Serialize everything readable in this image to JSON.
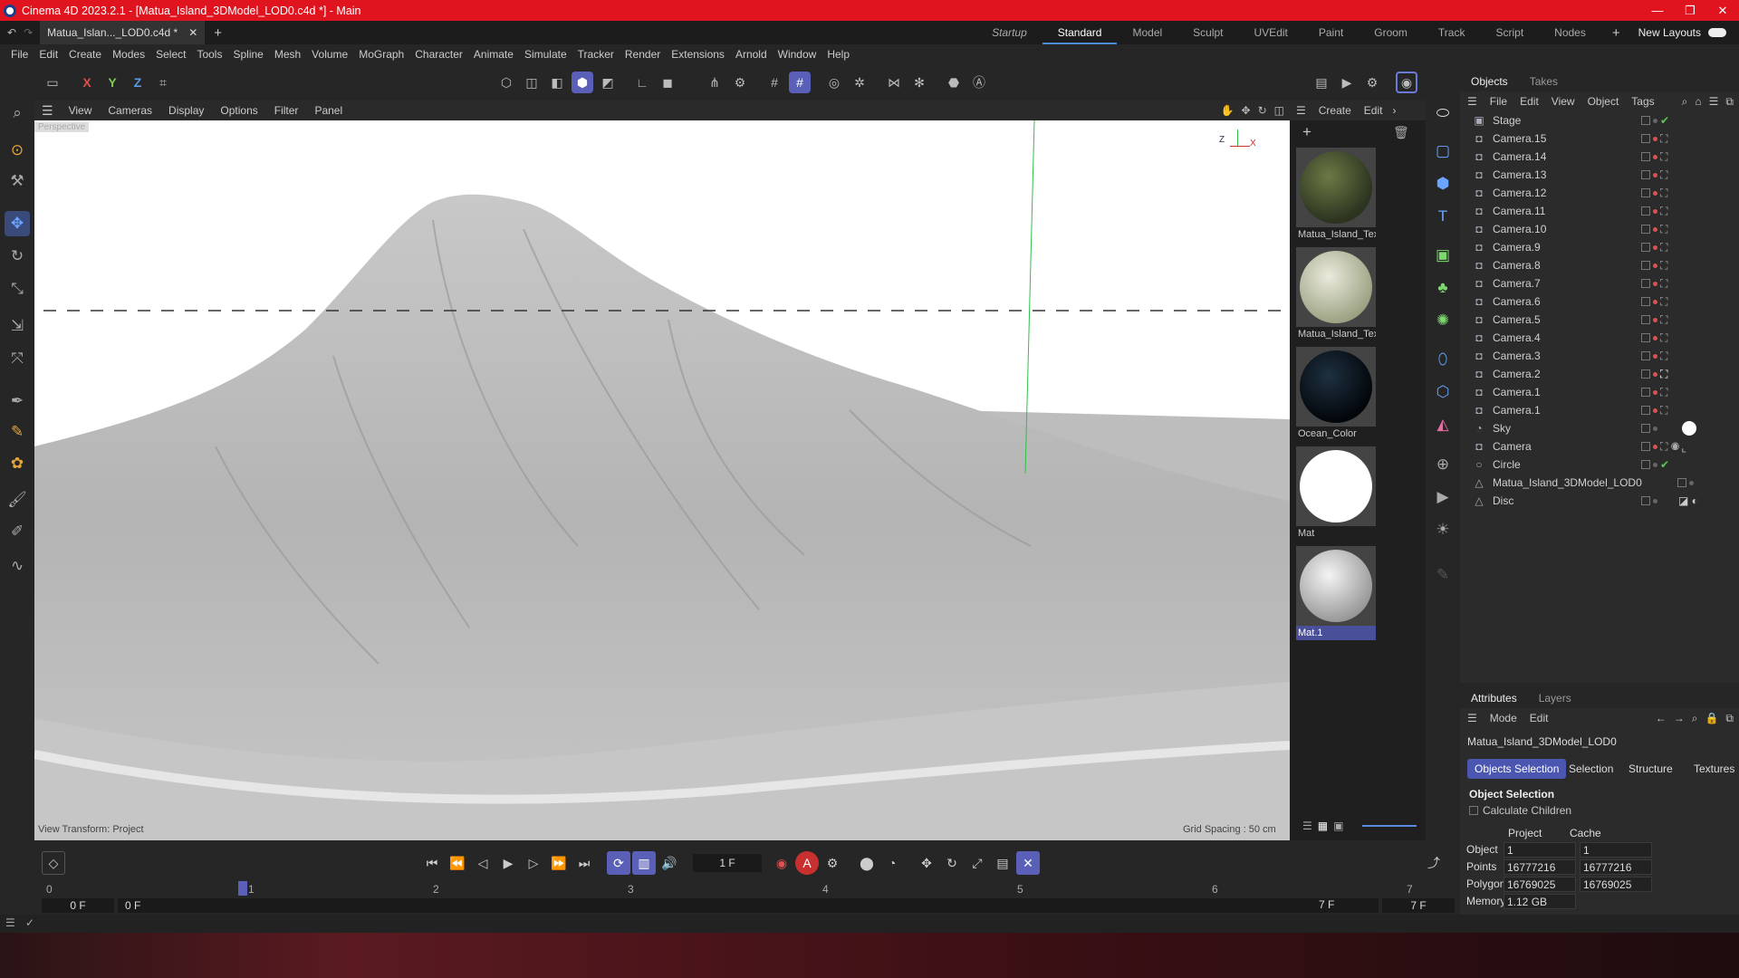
{
  "titlebar": {
    "title": "Cinema 4D 2023.2.1 - [Matua_Island_3DModel_LOD0.c4d *] - Main",
    "minimize": "—",
    "restore": "❐",
    "close": "✕"
  },
  "tabs": {
    "document": "Matua_Islan..._LOD0.c4d *",
    "close": "✕",
    "add": "+",
    "layouts": [
      "Startup",
      "Standard",
      "Model",
      "Sculpt",
      "UVEdit",
      "Paint",
      "Groom",
      "Track",
      "Script",
      "Nodes"
    ],
    "active_layout": "Standard",
    "new_layouts": "New Layouts"
  },
  "menu": [
    "File",
    "Edit",
    "Create",
    "Modes",
    "Select",
    "Tools",
    "Spline",
    "Mesh",
    "Volume",
    "MoGraph",
    "Character",
    "Animate",
    "Simulate",
    "Tracker",
    "Render",
    "Extensions",
    "Arnold",
    "Window",
    "Help"
  ],
  "toolbar": {
    "axes": [
      "X",
      "Y",
      "Z"
    ]
  },
  "viewport": {
    "menu": [
      "View",
      "Cameras",
      "Display",
      "Options",
      "Filter",
      "Panel"
    ],
    "camera_label": "Perspective",
    "view_transform": "View Transform: Project",
    "grid_spacing": "Grid Spacing : 50 cm",
    "axis_z": "Z",
    "axis_x": "X"
  },
  "materials": {
    "menu": [
      "Create",
      "Edit"
    ],
    "items": [
      {
        "label": "Matua_Island_Text",
        "color": "#3e4a2c"
      },
      {
        "label": "Matua_Island_Text",
        "color": "#c8ccb0"
      },
      {
        "label": "Ocean_Color",
        "color": "#0a1420"
      },
      {
        "label": "Mat",
        "color": "#ffffff"
      },
      {
        "label": "Mat.1",
        "color": "#d4d4d4"
      }
    ]
  },
  "objects": {
    "tabs": [
      "Objects",
      "Takes"
    ],
    "menu": [
      "File",
      "Edit",
      "View",
      "Object",
      "Tags"
    ],
    "rows": [
      {
        "name": "Stage",
        "icon": "▣"
      },
      {
        "name": "Camera.15",
        "icon": "◘"
      },
      {
        "name": "Camera.14",
        "icon": "◘"
      },
      {
        "name": "Camera.13",
        "icon": "◘"
      },
      {
        "name": "Camera.12",
        "icon": "◘"
      },
      {
        "name": "Camera.11",
        "icon": "◘"
      },
      {
        "name": "Camera.10",
        "icon": "◘"
      },
      {
        "name": "Camera.9",
        "icon": "◘"
      },
      {
        "name": "Camera.8",
        "icon": "◘"
      },
      {
        "name": "Camera.7",
        "icon": "◘"
      },
      {
        "name": "Camera.6",
        "icon": "◘"
      },
      {
        "name": "Camera.5",
        "icon": "◘"
      },
      {
        "name": "Camera.4",
        "icon": "◘"
      },
      {
        "name": "Camera.3",
        "icon": "◘"
      },
      {
        "name": "Camera.2",
        "icon": "◘"
      },
      {
        "name": "Camera.1",
        "icon": "◘"
      },
      {
        "name": "Camera.1",
        "icon": "◘"
      },
      {
        "name": "Sky",
        "icon": "◔"
      },
      {
        "name": "Camera",
        "icon": "◘"
      },
      {
        "name": "Circle",
        "icon": "○"
      },
      {
        "name": "Matua_Island_3DModel_LOD0",
        "icon": "△"
      },
      {
        "name": "Disc",
        "icon": "△"
      }
    ]
  },
  "attributes": {
    "tabs": [
      "Attributes",
      "Layers"
    ],
    "menu": [
      "Mode",
      "Edit"
    ],
    "object_name": "Matua_Island_3DModel_LOD0",
    "subtabs": [
      "Objects Selection",
      "Selection",
      "Structure",
      "Textures"
    ],
    "section": "Object Selection",
    "calc_children": "Calculate Children",
    "col_project": "Project",
    "col_cache": "Cache",
    "rows": [
      {
        "label": "Object",
        "project": "1",
        "cache": "1"
      },
      {
        "label": "Points",
        "project": "16777216",
        "cache": "16777216"
      },
      {
        "label": "Polygons",
        "project": "16769025",
        "cache": "16769025"
      },
      {
        "label": "Memory",
        "project": "1.12 GB",
        "cache": ""
      }
    ]
  },
  "timeline": {
    "current_frame": "1 F",
    "ruler": [
      "0",
      "1",
      "2",
      "3",
      "4",
      "5",
      "6",
      "7"
    ],
    "start": "0 F",
    "start2": "0 F",
    "end": "7 F",
    "end2": "7 F"
  }
}
